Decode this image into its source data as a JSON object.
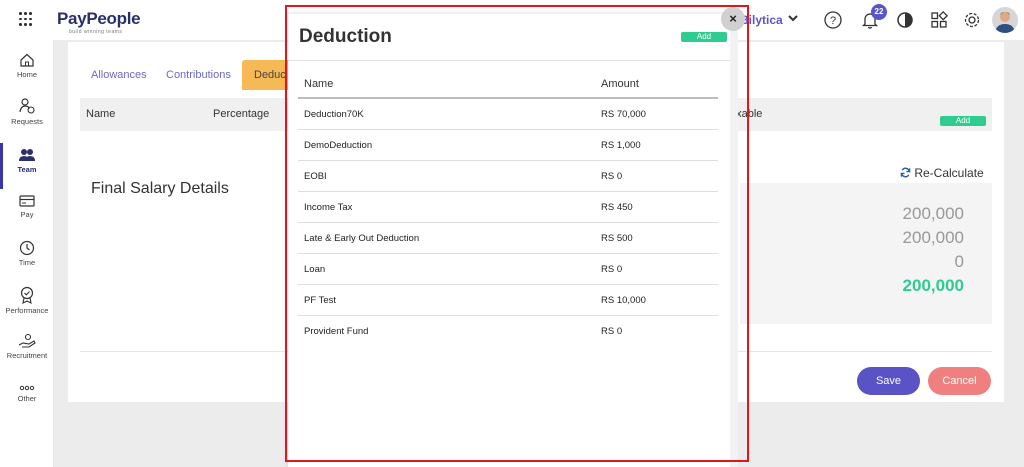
{
  "app": {
    "logo_text": "PayPeople",
    "logo_tagline": "build winning teams",
    "company_name": "Bilytica",
    "notification_count": "22"
  },
  "sidebar": {
    "items": [
      {
        "label": "Home",
        "icon": "home-icon"
      },
      {
        "label": "Requests",
        "icon": "requests-icon"
      },
      {
        "label": "Team",
        "icon": "team-icon",
        "active": true
      },
      {
        "label": "Pay",
        "icon": "pay-icon"
      },
      {
        "label": "Time",
        "icon": "clock-icon"
      },
      {
        "label": "Performance",
        "icon": "performance-icon"
      },
      {
        "label": "Recruitment",
        "icon": "recruitment-icon"
      },
      {
        "label": "Other",
        "icon": "more-icon"
      }
    ]
  },
  "page": {
    "tabs": [
      "Allowances",
      "Contributions",
      "Deduc"
    ],
    "table_headers": {
      "name": "Name",
      "percentage": "Percentage",
      "taxable": "axable"
    },
    "add_label": "Add",
    "final_title": "Final Salary Details",
    "recalculate_label": "Re-Calculate",
    "summary_values": [
      "200,000",
      "200,000",
      "0",
      "200,000"
    ],
    "save_label": "Save",
    "cancel_label": "Cancel"
  },
  "modal": {
    "title": "Deduction",
    "add_label": "Add",
    "close_label": "×",
    "columns": {
      "name": "Name",
      "amount": "Amount"
    },
    "rows": [
      {
        "name": "Deduction70K",
        "amount": "RS 70,000"
      },
      {
        "name": "DemoDeduction",
        "amount": "RS 1,000"
      },
      {
        "name": "EOBI",
        "amount": "RS 0"
      },
      {
        "name": "Income Tax",
        "amount": "RS 450"
      },
      {
        "name": "Late & Early Out Deduction",
        "amount": "RS 500"
      },
      {
        "name": "Loan",
        "amount": "RS 0"
      },
      {
        "name": "PF Test",
        "amount": "RS 10,000"
      },
      {
        "name": "Provident Fund",
        "amount": "RS 0"
      }
    ]
  },
  "colors": {
    "brand": "#2b2f6b",
    "accent": "#5a56c9",
    "green": "#2ecc8f",
    "active_tab": "#f7b955",
    "cancel": "#f08080",
    "highlight_frame": "#e3141b"
  }
}
